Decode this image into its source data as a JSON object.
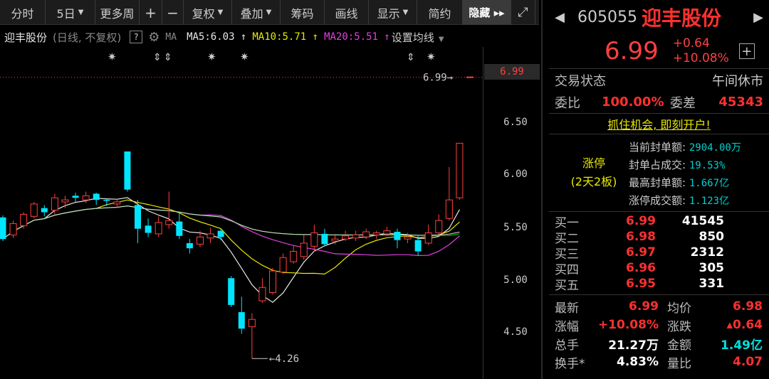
{
  "toolbar": {
    "items": [
      {
        "label": "分时"
      },
      {
        "label": "5日",
        "dropdown": true
      },
      {
        "label": "更多周",
        "dropdown": false
      },
      {
        "label": "+"
      },
      {
        "label": "−"
      },
      {
        "label": "复权",
        "dropdown": true
      },
      {
        "label": "叠加",
        "dropdown": true
      },
      {
        "label": "筹码"
      },
      {
        "label": "画线"
      },
      {
        "label": "显示",
        "dropdown": true
      },
      {
        "label": "简约"
      },
      {
        "label": "隐藏 ▸▸"
      },
      {
        "label": "⤢"
      }
    ]
  },
  "chart_header": {
    "name": "迎丰股份",
    "type": "(日线, 不复权)",
    "help": "?",
    "ma_label": "MA",
    "ma5": "MA5:6.03 ↑",
    "ma10": "MA10:5.71 ↑",
    "ma20": "MA20:5.51 ↑",
    "settings": "设置均线"
  },
  "chart_labels": {
    "last_price": "6.99",
    "last_price_box": "6.99",
    "low_label": "4.26"
  },
  "axis_labels": [
    "6.50",
    "6.00",
    "5.50",
    "5.00",
    "4.50"
  ],
  "colors": {
    "up": "#ff4040",
    "down": "#00e5ff",
    "ma5": "#e8e8e8",
    "ma10": "#e8e800",
    "ma20": "#e040e0",
    "ma_long": "#00c000"
  },
  "chart_data": {
    "type": "candlestick",
    "ylim": [
      4.22,
      7.05
    ],
    "candles": [
      [
        5.63,
        5.42,
        5.65,
        5.4
      ],
      [
        5.46,
        5.57,
        5.6,
        5.43
      ],
      [
        5.55,
        5.66,
        5.68,
        5.52
      ],
      [
        5.64,
        5.76,
        5.78,
        5.62
      ],
      [
        5.72,
        5.68,
        5.75,
        5.64
      ],
      [
        5.7,
        5.82,
        5.86,
        5.66
      ],
      [
        5.78,
        5.8,
        5.84,
        5.72
      ],
      [
        5.84,
        5.82,
        5.87,
        5.78
      ],
      [
        5.8,
        5.84,
        5.88,
        5.77
      ],
      [
        5.86,
        5.8,
        5.87,
        5.75
      ],
      [
        5.8,
        5.79,
        5.81,
        5.74
      ],
      [
        5.76,
        5.78,
        5.8,
        5.72
      ],
      [
        6.27,
        5.9,
        6.27,
        5.88
      ],
      [
        5.75,
        5.52,
        5.8,
        5.38
      ],
      [
        5.55,
        5.48,
        5.62,
        5.44
      ],
      [
        5.47,
        5.58,
        5.64,
        5.44
      ],
      [
        5.56,
        5.6,
        5.88,
        5.52
      ],
      [
        5.59,
        5.45,
        5.68,
        5.42
      ],
      [
        5.38,
        5.33,
        5.42,
        5.28
      ],
      [
        5.37,
        5.44,
        5.5,
        5.34
      ],
      [
        5.43,
        5.47,
        5.53,
        5.38
      ],
      [
        5.5,
        5.44,
        5.52,
        5.41
      ],
      [
        5.04,
        4.78,
        5.06,
        4.76
      ],
      [
        4.71,
        4.55,
        4.86,
        4.5
      ],
      [
        4.57,
        4.64,
        4.7,
        4.26
      ],
      [
        4.82,
        4.95,
        5.04,
        4.8
      ],
      [
        4.9,
        5.11,
        5.14,
        4.88
      ],
      [
        5.1,
        5.24,
        5.28,
        5.08
      ],
      [
        5.2,
        5.3,
        5.36,
        5.18
      ],
      [
        5.25,
        5.38,
        5.46,
        5.22
      ],
      [
        5.35,
        5.48,
        5.56,
        5.3
      ],
      [
        5.47,
        5.37,
        5.52,
        5.35
      ],
      [
        5.4,
        5.42,
        5.47,
        5.37
      ],
      [
        5.42,
        5.45,
        5.5,
        5.4
      ],
      [
        5.43,
        5.46,
        5.5,
        5.4
      ],
      [
        5.44,
        5.49,
        5.52,
        5.42
      ],
      [
        5.46,
        5.48,
        5.5,
        5.42
      ],
      [
        5.47,
        5.5,
        5.54,
        5.45
      ],
      [
        5.49,
        5.41,
        5.52,
        5.33
      ],
      [
        5.42,
        5.44,
        5.48,
        5.38
      ],
      [
        5.41,
        5.3,
        5.45,
        5.26
      ],
      [
        5.38,
        5.48,
        5.56,
        5.36
      ],
      [
        5.48,
        5.6,
        5.66,
        5.46
      ],
      [
        5.62,
        5.8,
        6.12,
        5.6
      ],
      [
        5.82,
        6.35,
        6.35,
        5.8
      ],
      [
        6.99,
        6.99,
        6.99,
        6.99
      ]
    ]
  },
  "panel": {
    "code": "605055",
    "name": "迎丰股份",
    "price": "6.99",
    "change": "+0.64",
    "change_pct": "+10.08%",
    "trade_status_label": "交易状态",
    "trade_status": "午间休市",
    "weibi_label": "委比",
    "weibi": "100.00%",
    "weicha_label": "委差",
    "weicha": "45343",
    "ad": "抓住机会, 即刻开户!",
    "limit_up_title": "涨停",
    "limit_up_sub": "(2天2板)",
    "limit_info": [
      {
        "k": "当前封单额:",
        "v": "2904.00万"
      },
      {
        "k": "封单占成交:",
        "v": "19.53%"
      },
      {
        "k": "最高封单额:",
        "v": "1.667亿"
      },
      {
        "k": "涨停成交额:",
        "v": "1.123亿"
      }
    ],
    "bids": [
      {
        "k": "买一",
        "p": "6.99",
        "v": "41545"
      },
      {
        "k": "买二",
        "p": "6.98",
        "v": "850"
      },
      {
        "k": "买三",
        "p": "6.97",
        "v": "2312"
      },
      {
        "k": "买四",
        "p": "6.96",
        "v": "305"
      },
      {
        "k": "买五",
        "p": "6.95",
        "v": "331"
      }
    ],
    "stats": [
      {
        "k": "最新",
        "v": "6.99",
        "vc": "red",
        "k2": "均价",
        "v2": "6.98",
        "v2c": "red"
      },
      {
        "k": "涨幅",
        "v": "+10.08%",
        "vc": "red",
        "k2": "涨跌",
        "v2": "▴0.64",
        "v2c": "red"
      },
      {
        "k": "总手",
        "v": "21.27万",
        "vc": "white",
        "k2": "金额",
        "v2": "1.49亿",
        "v2c": "cyan"
      },
      {
        "k": "换手*",
        "v": "4.83%",
        "vc": "white",
        "k2": "量比",
        "v2": "4.07",
        "v2c": "red"
      }
    ]
  }
}
